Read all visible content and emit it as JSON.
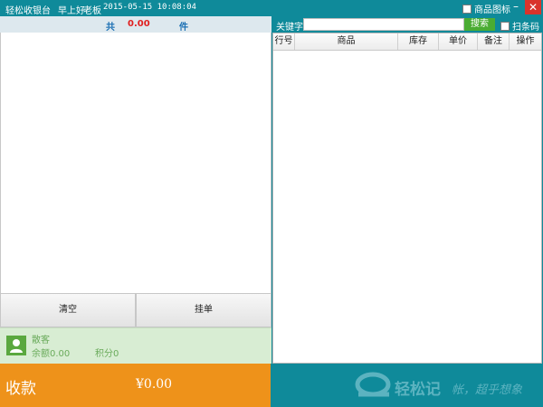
{
  "titlebar": {
    "app_title": "轻松收银台",
    "greeting": "早上好",
    "user": "老板",
    "datetime": "2015-05-15 10:08:04",
    "product_icon_label": "商品图标",
    "product_icon_checked": false,
    "minimize_glyph": "–",
    "close_glyph": "✕"
  },
  "cart_summary": {
    "total_label": "共",
    "amount": "0.00",
    "unit": "件"
  },
  "buttons": {
    "clear": "清空",
    "hold": "挂单"
  },
  "member": {
    "name": "散客",
    "balance": "余额0.00",
    "points": "积分0"
  },
  "payment": {
    "label": "收款",
    "total": "¥0.00"
  },
  "search": {
    "keyword_label": "关键字",
    "value": "",
    "button": "搜索",
    "scan_label": "扫条码",
    "scan_checked": false
  },
  "product_table": {
    "columns": [
      "行号",
      "商品",
      "库存",
      "单价",
      "备注",
      "操作"
    ],
    "rows": []
  },
  "footer": {
    "brand": "轻松记",
    "slogan": "帐，超乎想象"
  },
  "colors": {
    "teal": "#0f8a9a",
    "orange": "#ee921a",
    "member_bg": "#d8edd3",
    "close_red": "#d9332b",
    "search_green": "#4aac33"
  }
}
